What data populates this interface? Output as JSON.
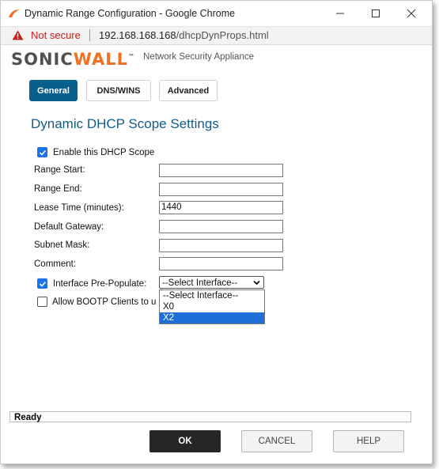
{
  "window": {
    "title": "Dynamic Range Configuration - Google Chrome"
  },
  "address_bar": {
    "security_label": "Not secure",
    "url_host": "192.168.168.168",
    "url_path": "/dhcpDynProps.html"
  },
  "header": {
    "logo_text_1": "SONIC",
    "logo_text_2": "WALL",
    "logo_tm": "™",
    "tagline": "Network Security Appliance"
  },
  "tabs": [
    {
      "label": "General",
      "active": true
    },
    {
      "label": "DNS/WINS",
      "active": false
    },
    {
      "label": "Advanced",
      "active": false
    }
  ],
  "page_title": "Dynamic DHCP Scope Settings",
  "form": {
    "enable_scope": {
      "label": "Enable this DHCP Scope",
      "checked": true
    },
    "range_start": {
      "label": "Range Start:",
      "value": ""
    },
    "range_end": {
      "label": "Range End:",
      "value": ""
    },
    "lease_time": {
      "label": "Lease Time (minutes):",
      "value": "1440"
    },
    "default_gateway": {
      "label": "Default Gateway:",
      "value": ""
    },
    "subnet_mask": {
      "label": "Subnet Mask:",
      "value": ""
    },
    "comment": {
      "label": "Comment:",
      "value": ""
    },
    "interface_prepopulate": {
      "label": "Interface Pre-Populate:",
      "checked": true,
      "selected": "--Select Interface--",
      "options": [
        "--Select Interface--",
        "X0",
        "X2"
      ],
      "highlighted": "X2"
    },
    "allow_bootp": {
      "label": "Allow BOOTP Clients to u",
      "checked": false
    }
  },
  "status": "Ready",
  "buttons": {
    "ok": "OK",
    "cancel": "CANCEL",
    "help": "HELP"
  },
  "colors": {
    "accent": "#075f8c",
    "heading": "#135c85",
    "brand_orange": "#f36f21",
    "warning_red": "#c5221f",
    "highlight": "#1e6fd8"
  }
}
